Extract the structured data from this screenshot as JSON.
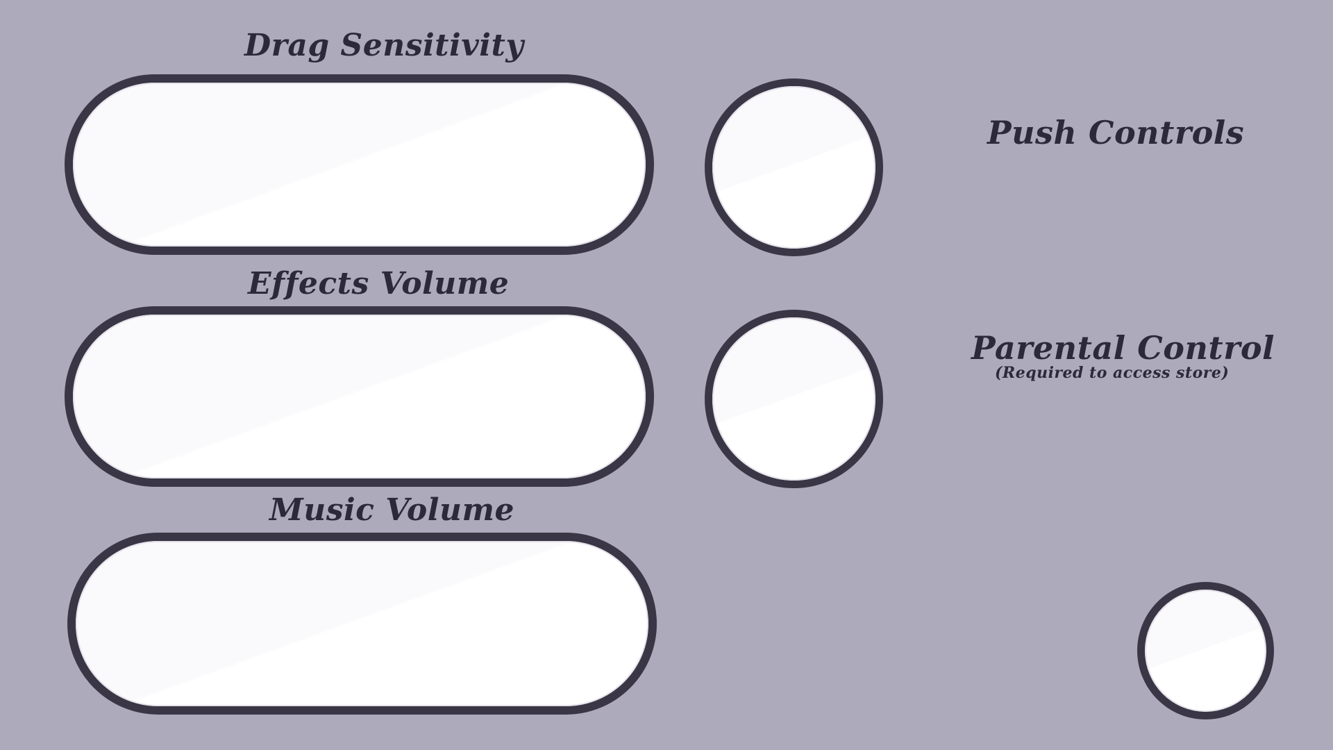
{
  "settings": {
    "drag_sensitivity": {
      "label": "Drag Sensitivity"
    },
    "effects_volume": {
      "label": "Effects Volume"
    },
    "music_volume": {
      "label": "Music Volume"
    },
    "push_controls": {
      "label": "Push Controls"
    },
    "parental_control": {
      "label": "Parental Control",
      "sublabel": "(Required to access store)"
    }
  },
  "colors": {
    "background": "#adabbb",
    "outline": "#3a3646",
    "fill": "#ffffff",
    "text": "#2c2a3a"
  }
}
